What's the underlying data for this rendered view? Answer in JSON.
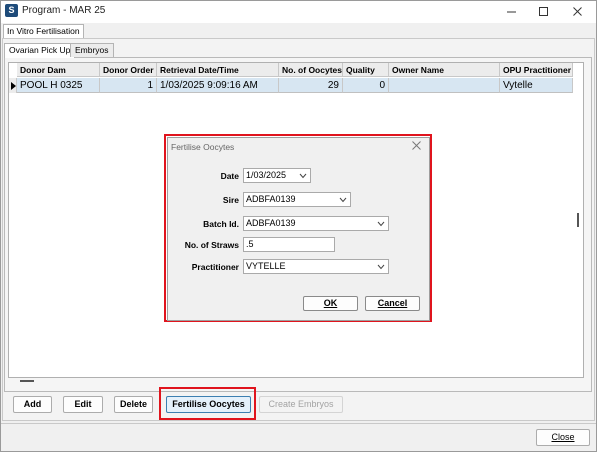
{
  "window": {
    "title": "Program - MAR 25",
    "minimize_icon": "minimize-icon",
    "maximize_icon": "maximize-icon",
    "close_icon": "close-icon"
  },
  "module_tab": "In Vitro Fertilisation",
  "subtabs": [
    "Ovarian Pick Up",
    "Embryos"
  ],
  "grid": {
    "columns": [
      "Donor Dam",
      "Donor Order",
      "Retrieval Date/Time",
      "No. of Oocytes",
      "Quality",
      "Owner Name",
      "OPU Practitioner"
    ],
    "rows": [
      [
        "POOL H 0325",
        "1",
        "1/03/2025 9:09:16 AM",
        "29",
        "0",
        "",
        "Vytelle"
      ]
    ]
  },
  "actions": {
    "add": "Add",
    "edit": "Edit",
    "delete": "Delete",
    "fertilise": "Fertilise Oocytes",
    "create_embryos": "Create Embryos"
  },
  "close_label": "Close",
  "dialog": {
    "title": "Fertilise Oocytes",
    "date_label": "Date",
    "date_value": "1/03/2025",
    "sire_label": "Sire",
    "sire_value": "ADBFA0139",
    "batch_label": "Batch Id.",
    "batch_value": "ADBFA0139",
    "straws_label": "No. of Straws",
    "straws_value": ".5",
    "practitioner_label": "Practitioner",
    "practitioner_value": "VYTELLE",
    "ok_label": "OK",
    "cancel_label": "Cancel"
  },
  "colors": {
    "highlight_border": "#e0141d",
    "selected_row": "#d7e6f2",
    "app_icon": "#1e4b7a"
  }
}
